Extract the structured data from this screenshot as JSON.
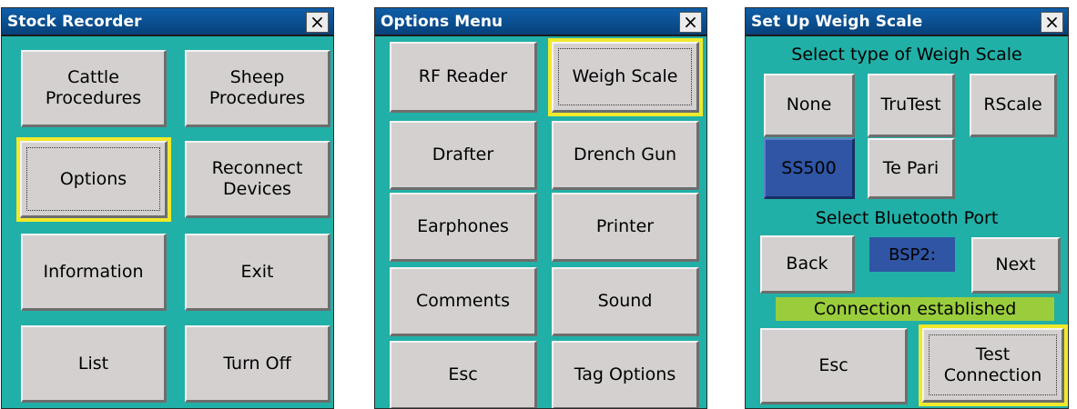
{
  "stock_recorder": {
    "title": "Stock Recorder",
    "close_label": "×",
    "buttons": {
      "cattle": "Cattle\nProcedures",
      "sheep": "Sheep\nProcedures",
      "options": "Options",
      "reconnect": "Reconnect\nDevices",
      "information": "Information",
      "exit": "Exit",
      "list": "List",
      "turn_off": "Turn Off"
    }
  },
  "options_menu": {
    "title": "Options Menu",
    "close_label": "×",
    "buttons": {
      "rf_reader": "RF Reader",
      "weigh_scale": "Weigh Scale",
      "drafter": "Drafter",
      "drench_gun": "Drench Gun",
      "earphones": "Earphones",
      "printer": "Printer",
      "comments": "Comments",
      "sound": "Sound",
      "esc": "Esc",
      "tag_options": "Tag Options"
    }
  },
  "weigh_scale_setup": {
    "title": "Set Up Weigh Scale",
    "close_label": "×",
    "select_type_heading": "Select type of Weigh Scale",
    "scale_types": {
      "none": "None",
      "trutest": "TruTest",
      "rscale": "RScale",
      "ss500": "SS500",
      "te_pari": "Te Pari"
    },
    "selected_scale": "SS500",
    "select_port_heading": "Select Bluetooth Port",
    "back_label": "Back",
    "port_value": "BSP2:",
    "next_label": "Next",
    "status_text": "Connection established",
    "esc_label": "Esc",
    "test_connection_label": "Test\nConnection"
  },
  "colors": {
    "window_bg": "#21b0a7",
    "titlebar": "#0f5ea9",
    "button_face": "#d4d0d0",
    "focus_outline": "#f1e92b",
    "selected": "#2f55a4",
    "status_ok": "#9acd3c"
  }
}
